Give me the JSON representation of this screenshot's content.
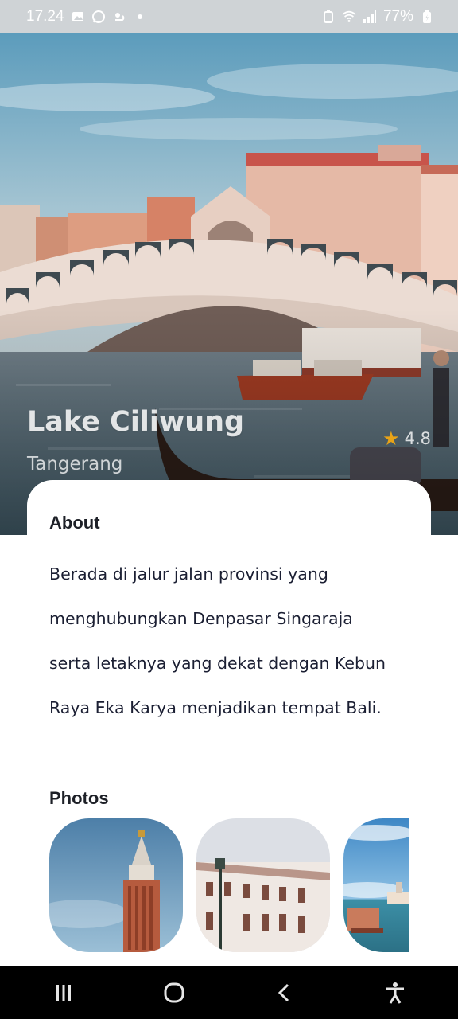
{
  "status_bar": {
    "time": "17.24",
    "battery": "77%",
    "left_icons": [
      "gallery-icon",
      "whatsapp-icon",
      "weather-icon",
      "dot-icon"
    ],
    "right_icons": [
      "battery-saver-icon",
      "wifi-icon",
      "signal-icon",
      "battery-icon"
    ]
  },
  "place": {
    "name": "Lake Ciliwung",
    "location": "Tangerang",
    "rating": "4.8"
  },
  "about": {
    "heading": "About",
    "text": "Berada di jalur jalan provinsi yang menghubungkan Denpasar Singaraja serta letaknya yang dekat dengan Kebun Raya Eka Karya menjadikan tempat Bali."
  },
  "photos": {
    "heading": "Photos",
    "items": [
      "bell-tower-photo",
      "building-photo",
      "venice-canal-photo"
    ]
  },
  "colors": {
    "accent_star": "#e8a317",
    "text_dark": "#1b1f33",
    "status_bar": "#cfd3d6"
  },
  "nav_bar": {
    "buttons": [
      "recent-apps-icon",
      "home-icon",
      "back-icon",
      "accessibility-icon"
    ]
  }
}
